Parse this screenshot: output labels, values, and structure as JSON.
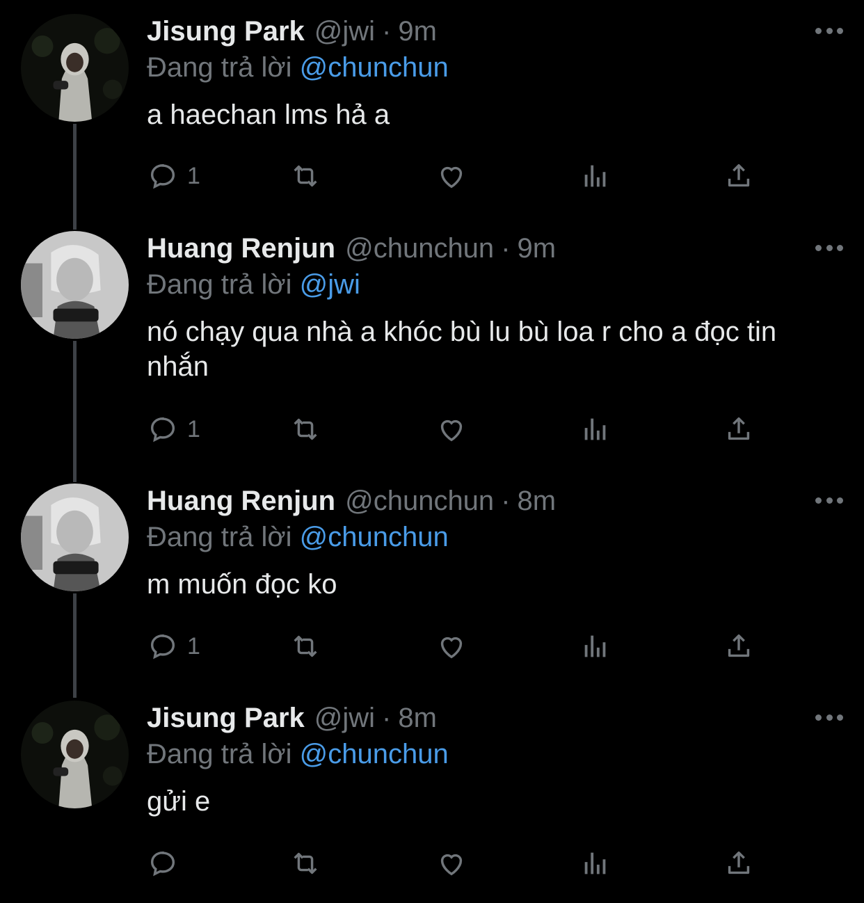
{
  "colors": {
    "background": "#000000",
    "accent": "#4a9ce8",
    "muted": "#71767b",
    "text": "#e7e9ea"
  },
  "tweets": [
    {
      "name": "Jisung Park",
      "handle": "@jwi",
      "dot": "·",
      "time": "9m",
      "replying_prefix": "Đang trả lời",
      "replying_to": "@chunchun",
      "text": "a haechan lms hả a",
      "reply_count": "1",
      "avatar": "avatar-hoodie"
    },
    {
      "name": "Huang Renjun",
      "handle": "@chunchun",
      "dot": "·",
      "time": "9m",
      "replying_prefix": "Đang trả lời",
      "replying_to": "@jwi",
      "text": "nó chạy qua nhà a khóc bù lu bù loa r cho a đọc tin nhắn",
      "reply_count": "1",
      "avatar": "avatar-gaming"
    },
    {
      "name": "Huang Renjun",
      "handle": "@chunchun",
      "dot": "·",
      "time": "8m",
      "replying_prefix": "Đang trả lời",
      "replying_to": "@chunchun",
      "text": "m muốn đọc ko",
      "reply_count": "1",
      "avatar": "avatar-gaming"
    },
    {
      "name": "Jisung Park",
      "handle": "@jwi",
      "dot": "·",
      "time": "8m",
      "replying_prefix": "Đang trả lời",
      "replying_to": "@chunchun",
      "text": "gửi e",
      "reply_count": "",
      "avatar": "avatar-hoodie"
    }
  ],
  "icons": {
    "reply": "reply-icon",
    "retweet": "retweet-icon",
    "like": "like-icon",
    "views": "views-icon",
    "share": "share-icon",
    "more": "more-icon"
  }
}
